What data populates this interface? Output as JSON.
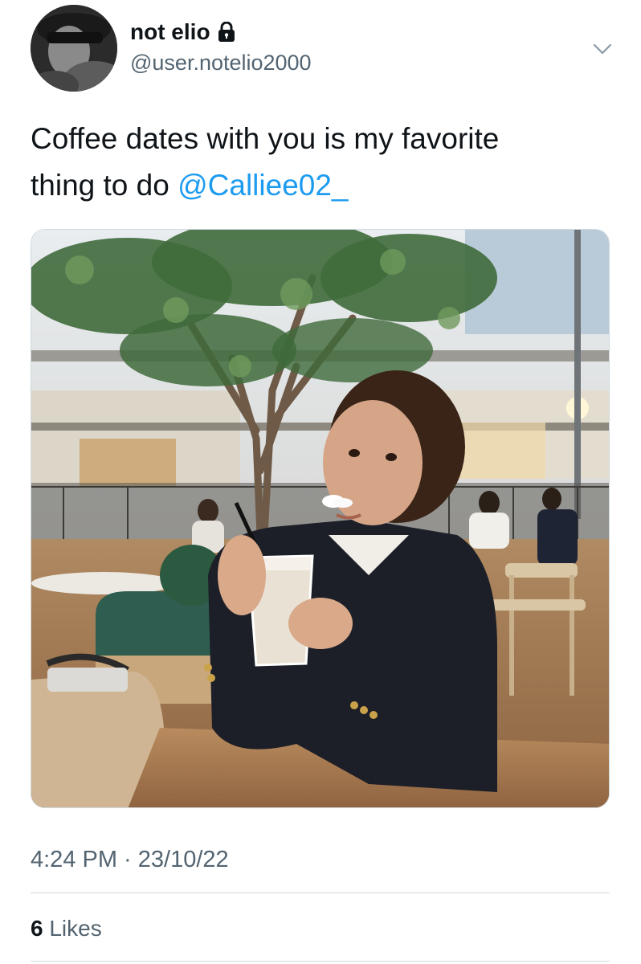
{
  "author": {
    "display_name": "not elio",
    "handle": "@user.notelio2000",
    "protected_icon": "lock-icon",
    "avatar_icon": "profile-photo"
  },
  "menu_icon": "chevron-down-icon",
  "tweet": {
    "text_lines": [
      "Coffee dates with you is my favorite",
      "thing to do "
    ],
    "mention": "@Calliee02_",
    "media": {
      "description_icon": "photo"
    }
  },
  "meta": {
    "timestamp": "4:24 PM · 23/10/22"
  },
  "engagement": {
    "likes_count": "6",
    "likes_label": " Likes"
  },
  "colors": {
    "text": "#0f1419",
    "secondary": "#536471",
    "link": "#1d9bf0",
    "divider": "#cfd9de"
  }
}
